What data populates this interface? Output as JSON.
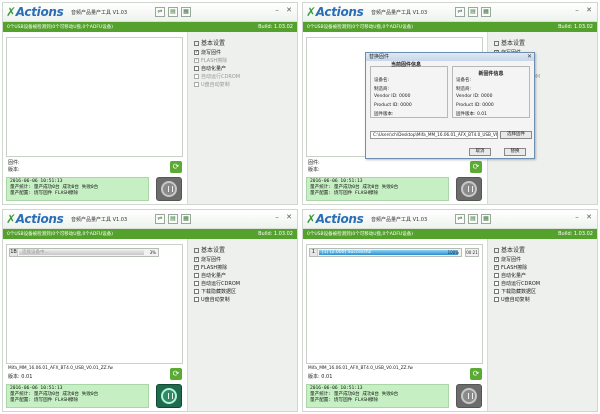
{
  "app": {
    "logo": "Actions",
    "title": "音频产品量产工具 V1.03",
    "build": "Build: 1.03.02",
    "device_status": "0个USB设备被检测到(0个可移动U盘,0个ADFU设备)"
  },
  "settings": {
    "title": "基本设置",
    "items_a": [
      {
        "label": "烧写固件",
        "checked": true,
        "enabled": true
      },
      {
        "label": "FLASH擦除",
        "checked": true,
        "enabled": false
      },
      {
        "label": "自动化量产",
        "checked": false,
        "enabled": true
      },
      {
        "label": "自动运行CDROM",
        "checked": false,
        "enabled": false
      },
      {
        "label": "U盘自动复制",
        "checked": false,
        "enabled": false
      }
    ],
    "items_b": [
      {
        "label": "烧写固件",
        "checked": true,
        "enabled": true
      },
      {
        "label": "FLASH擦除",
        "checked": true,
        "enabled": true
      },
      {
        "label": "自动化量产",
        "checked": false,
        "enabled": true
      },
      {
        "label": "自动运行CDROM",
        "checked": false,
        "enabled": true
      },
      {
        "label": "下载隐藏数据区",
        "checked": false,
        "enabled": true
      },
      {
        "label": "U盘自动复制",
        "checked": false,
        "enabled": true
      }
    ]
  },
  "firmware": {
    "label": "固件:",
    "version_label": "版本:",
    "path": "Mifa_MM_16.06.01_AFX_BT4.0_USB_V0.01_ZZ.fw",
    "version": "版本: 0.01"
  },
  "log": {
    "date": "2016-06-06 10:51:13",
    "stats": "量产统计: 量产成功0台 成功0台 失败0台",
    "config": "量产配置: 烧写固件 FLASH擦除"
  },
  "dialog": {
    "title": "替换固件",
    "current_head": "当前固件信息",
    "new_head": "新固件信息",
    "fields": [
      "设备名:",
      "制造商:",
      "Vendor ID: 0000",
      "Product ID: 0000",
      "固件版本:"
    ],
    "new_version": "固件版本: 0.01",
    "path": "C:\\Users\\ch\\Desktop\\Mifa_MM_16.06.01_AFX_BT4.0_USB_V0.01_ZZ.fw",
    "browse": "选择固件",
    "cancel": "取消",
    "replace": "替换"
  },
  "progress": {
    "row3": {
      "index": "1B",
      "text": "连接设备中...",
      "percent_label": "3%",
      "fill": 0.92
    },
    "row4": {
      "index": "1",
      "text": "[1] (2.000) Successful",
      "percent_label": "100%",
      "time": "00:21",
      "fill": 1.0
    }
  },
  "icons": [
    "usb-icon",
    "document-icon",
    "settings-icon",
    "minimize-icon",
    "close-icon",
    "refresh-icon",
    "power-icon"
  ],
  "colors": {
    "accent": "#55a12e",
    "log_bg": "#c6f0c3",
    "brand": "#2a6fb5"
  }
}
